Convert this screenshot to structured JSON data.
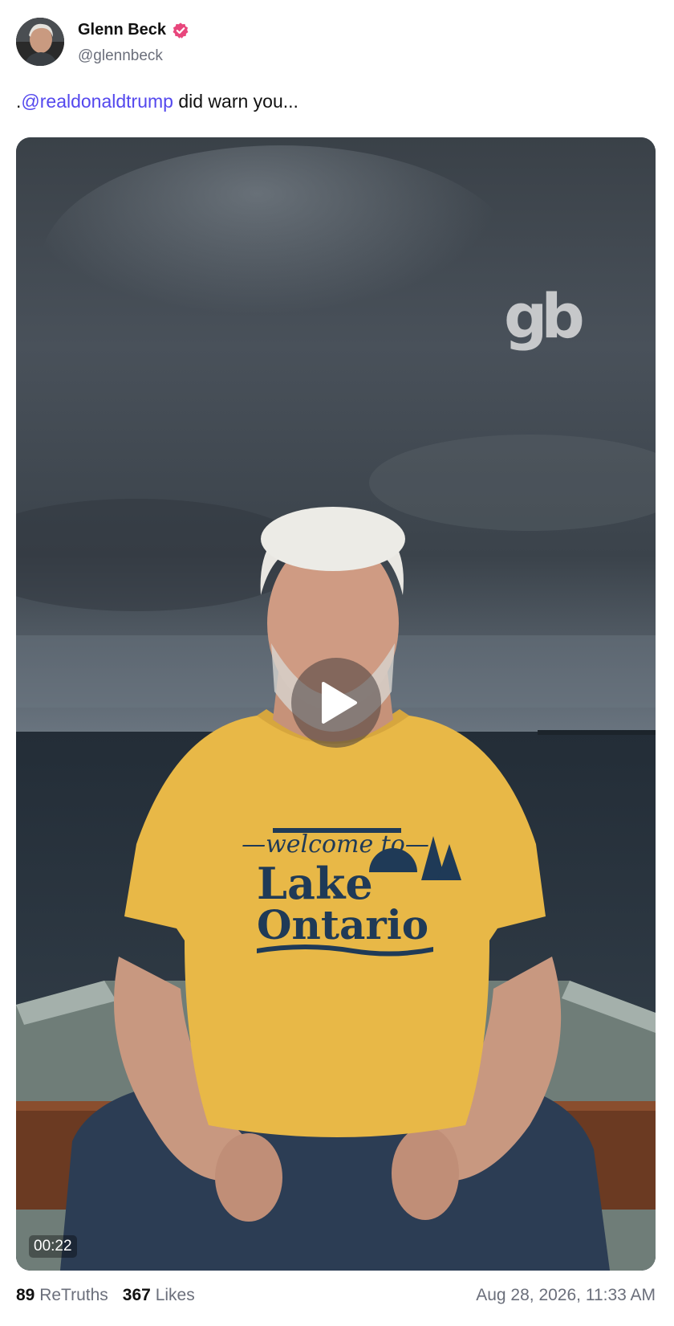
{
  "author": {
    "display_name": "Glenn Beck",
    "handle": "@glennbeck",
    "verified": true,
    "verified_badge_color": "#e8467c"
  },
  "post": {
    "prefix": ".",
    "mention": "@realdonaldtrump",
    "text": " did warn you...",
    "mention_color": "#5448ee"
  },
  "media": {
    "type": "video",
    "watermark": "gb",
    "duration": "00:22",
    "play_icon": "play-icon",
    "shirt_line_1": "—welcome to—",
    "shirt_line_2": "Lake",
    "shirt_line_3": "Ontario"
  },
  "stats": {
    "retruths_count": "89",
    "retruths_label": "ReTruths",
    "likes_count": "367",
    "likes_label": "Likes"
  },
  "timestamp": "Aug 28, 2026, 11:33 AM"
}
